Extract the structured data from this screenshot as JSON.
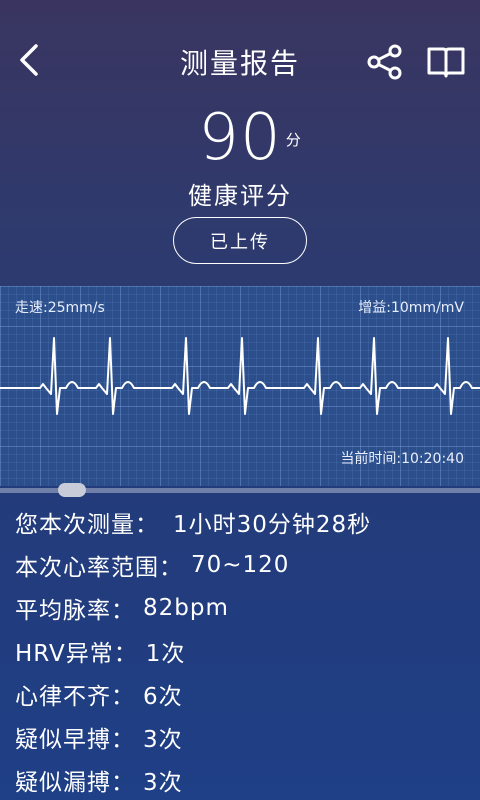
{
  "header": {
    "title": "测量报告"
  },
  "score": {
    "value": "90",
    "unit": "分",
    "label": "健康评分"
  },
  "upload_button": "已上传",
  "ecg": {
    "speed": "走速:25mm/s",
    "gain": "增益:10mm/mV",
    "current_time": "当前时间:10:20:40"
  },
  "stats": [
    {
      "label": "您本次测量：",
      "value": "1小时30分钟28秒"
    },
    {
      "label": "本次心率范围：",
      "value": "70~120"
    },
    {
      "label": "平均脉率：",
      "value": "82bpm"
    },
    {
      "label": "HRV异常：",
      "value": "1次"
    },
    {
      "label": "心律不齐：",
      "value": "6次"
    },
    {
      "label": "疑似早搏：",
      "value": "3次"
    },
    {
      "label": "疑似漏搏：",
      "value": "3次"
    }
  ],
  "icons": [
    "back-icon",
    "share-icon",
    "book-icon"
  ]
}
